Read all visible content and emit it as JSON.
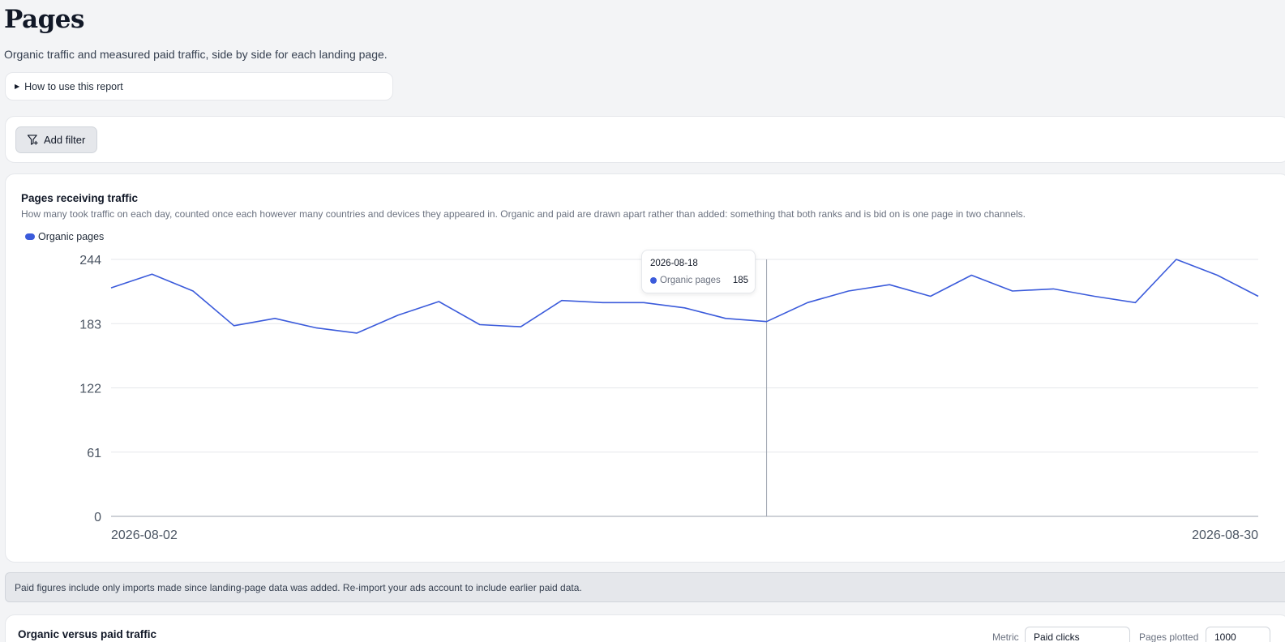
{
  "page": {
    "title": "Pages",
    "subtitle": "Organic traffic and measured paid traffic, side by side for each landing page."
  },
  "howto": {
    "label": "How to use this report"
  },
  "filters": {
    "add_label": "Add filter"
  },
  "chart_card": {
    "title": "Pages receiving traffic",
    "description": "How many took traffic on each day, counted once each however many countries and devices they appeared in. Organic and paid are drawn apart rather than added: something that both ranks and is bid on is one page in two channels."
  },
  "tooltip": {
    "date": "2026-08-18",
    "series": "Organic pages",
    "value": "185"
  },
  "notice": {
    "text": "Paid figures include only imports made since landing-page data was added. Re-import your ads account to include earlier paid data."
  },
  "bottom_card": {
    "title": "Organic versus paid traffic",
    "metric_label": "Metric",
    "metric_value": "Paid clicks",
    "pages_label": "Pages plotted",
    "pages_value": "1000"
  },
  "colors": {
    "series": "#3b5bdb",
    "grid": "#e5e7eb",
    "axis": "#9ca3af"
  },
  "chart_data": {
    "type": "line",
    "x": [
      "2026-08-02",
      "2026-08-03",
      "2026-08-04",
      "2026-08-05",
      "2026-08-06",
      "2026-08-07",
      "2026-08-08",
      "2026-08-09",
      "2026-08-10",
      "2026-08-11",
      "2026-08-12",
      "2026-08-13",
      "2026-08-14",
      "2026-08-15",
      "2026-08-16",
      "2026-08-17",
      "2026-08-18",
      "2026-08-19",
      "2026-08-20",
      "2026-08-21",
      "2026-08-22",
      "2026-08-23",
      "2026-08-24",
      "2026-08-25",
      "2026-08-26",
      "2026-08-27",
      "2026-08-28",
      "2026-08-29",
      "2026-08-30"
    ],
    "series": [
      {
        "name": "Organic pages",
        "values": [
          217,
          230,
          214,
          181,
          188,
          179,
          174,
          191,
          204,
          182,
          180,
          205,
          203,
          203,
          198,
          188,
          185,
          203,
          214,
          220,
          209,
          229,
          214,
          216,
          209,
          203,
          244,
          229,
          209
        ]
      }
    ],
    "xtick_labels": [
      "2026-08-02",
      "2026-08-30"
    ],
    "yticks": [
      0,
      61,
      122,
      183,
      244
    ],
    "ylim": [
      0,
      244
    ],
    "grid": true,
    "legend": "top-left"
  }
}
